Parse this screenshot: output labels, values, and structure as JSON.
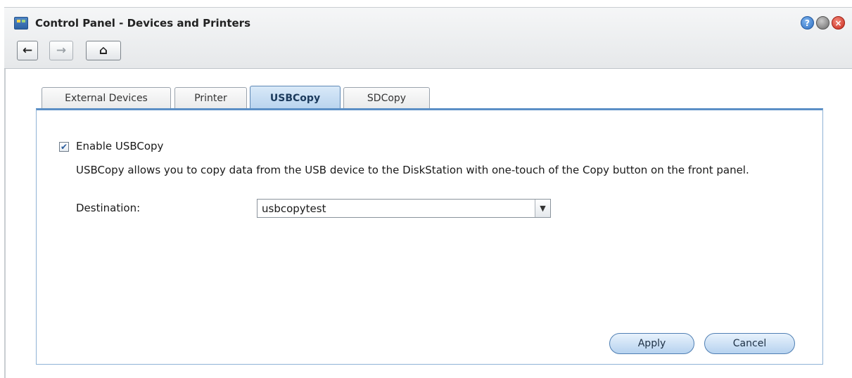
{
  "window": {
    "title": "Control Panel - Devices and Printers",
    "icons": {
      "app": "control-panel-icon",
      "help": "help-icon",
      "minimize": "minimize-icon",
      "close": "close-icon"
    },
    "colors": {
      "accent": "#5b8fc6",
      "close": "#c92a1c",
      "help": "#2f6fc2"
    }
  },
  "toolbar": {
    "back_icon": "←",
    "forward_icon": "→",
    "home_icon": "⌂"
  },
  "tabs": [
    {
      "label": "External Devices",
      "active": false
    },
    {
      "label": "Printer",
      "active": false
    },
    {
      "label": "USBCopy",
      "active": true
    },
    {
      "label": "SDCopy",
      "active": false
    }
  ],
  "usbcopy": {
    "enable_label": "Enable USBCopy",
    "enabled": true,
    "description": "USBCopy allows you to copy data from the USB device to the DiskStation with one-touch of the Copy button on the front panel.",
    "destination_label": "Destination:",
    "destination_value": "usbcopytest"
  },
  "buttons": {
    "apply": "Apply",
    "cancel": "Cancel"
  }
}
